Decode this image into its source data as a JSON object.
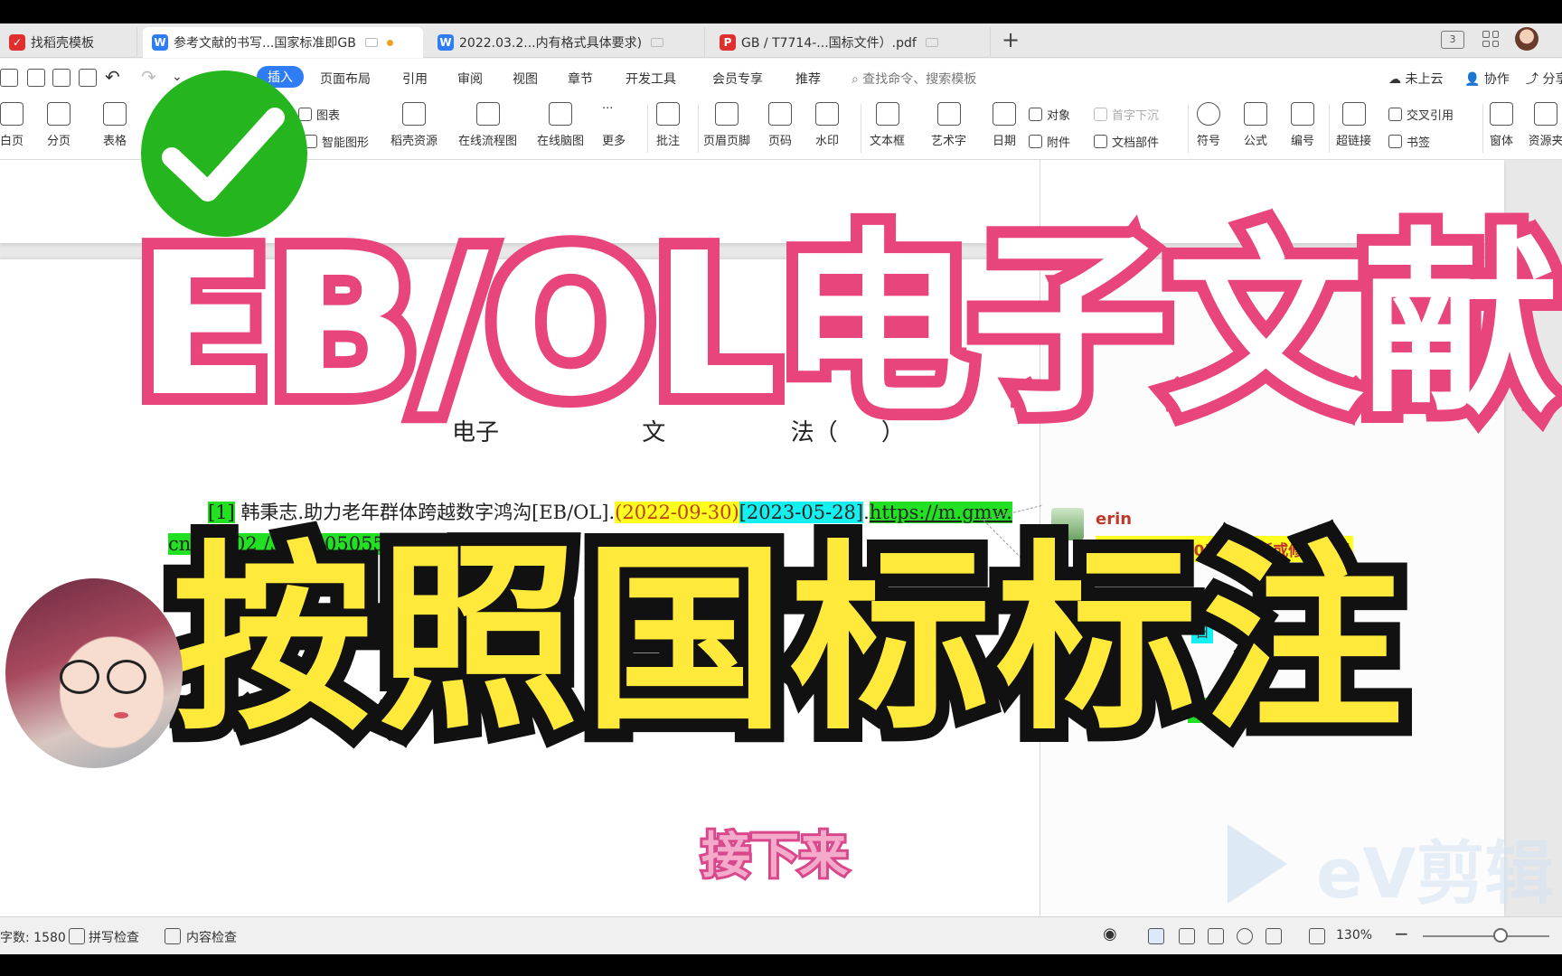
{
  "tabs": [
    {
      "label": "找稻壳模板",
      "icon": "wps-logo-icon",
      "color": "#e0302e"
    },
    {
      "label": "参考文献的书写...国家标准即GB",
      "icon": "word-doc-icon",
      "color": "#2f7df6"
    },
    {
      "label": "2022.03.2...内有格式具体要求)",
      "icon": "word-doc-icon",
      "color": "#2f7df6"
    },
    {
      "label": "GB / T7714-...国标文件）.pdf",
      "icon": "pdf-icon",
      "color": "#e0302e"
    }
  ],
  "menu": {
    "items": [
      "插入",
      "页面布局",
      "引用",
      "审阅",
      "视图",
      "章节",
      "开发工具",
      "会员专享",
      "推荐"
    ],
    "active": "插入",
    "search_placeholder": "查找命令、搜索模板",
    "right": [
      "未上云",
      "协作",
      "分享"
    ]
  },
  "ribbon": {
    "blank_page": "白页",
    "page_break": "分页",
    "table": "表格",
    "chart": "图表",
    "smart_art": "智能图形",
    "daoke": "稻壳资源",
    "flowchart": "在线流程图",
    "mindmap": "在线脑图",
    "more": "更多",
    "comment": "批注",
    "header_footer": "页眉页脚",
    "page_number": "页码",
    "watermark": "水印",
    "textbox": "文本框",
    "wordart": "艺术字",
    "date": "日期",
    "object": "对象",
    "attachment": "附件",
    "dropcap": "首字下沉",
    "doc_part": "文档部件",
    "symbol": "符号",
    "formula": "公式",
    "numbering": "编号",
    "hyperlink": "超链接",
    "crossref": "交叉引用",
    "bookmark": "书签",
    "form": "窗体",
    "resources": "资源夹"
  },
  "document": {
    "heading_a": "电子",
    "heading_b": "文",
    "heading_c": "法（",
    "heading_d": "）",
    "ref_num": "[1]",
    "ref_main": "韩秉志.助力老年群体跨越数字鸿沟[EB/OL].",
    "ref_pub": "(2022-09-30)",
    "ref_cite": "[2023-05-28]",
    "ref_dot": ".",
    "ref_url": "https://m.gmw.",
    "ref_line2": "cn/     a/202   /30/36050557.html"
  },
  "comment": {
    "author": "erin",
    "text": "(2022-09-30)是指更新或修改日期",
    "frag1": "日",
    "frag2": "径"
  },
  "status": {
    "word_count": "字数: 1580",
    "spell": "拼写检查",
    "content_check": "内容检查",
    "zoom": "130%"
  },
  "overlay": {
    "title_top": "EB/OL电子文献",
    "title_bottom": "按照国标标注",
    "subtitle": "接下来",
    "watermark": "eV剪辑"
  },
  "colors": {
    "accent": "#2f7df6",
    "title_pink": "#e8457d",
    "title_yellow": "#ffe93a",
    "check_green": "#24b51f",
    "highlight_green": "#22e022",
    "highlight_yellow": "#ffff20",
    "highlight_cyan": "#14f0f0"
  }
}
